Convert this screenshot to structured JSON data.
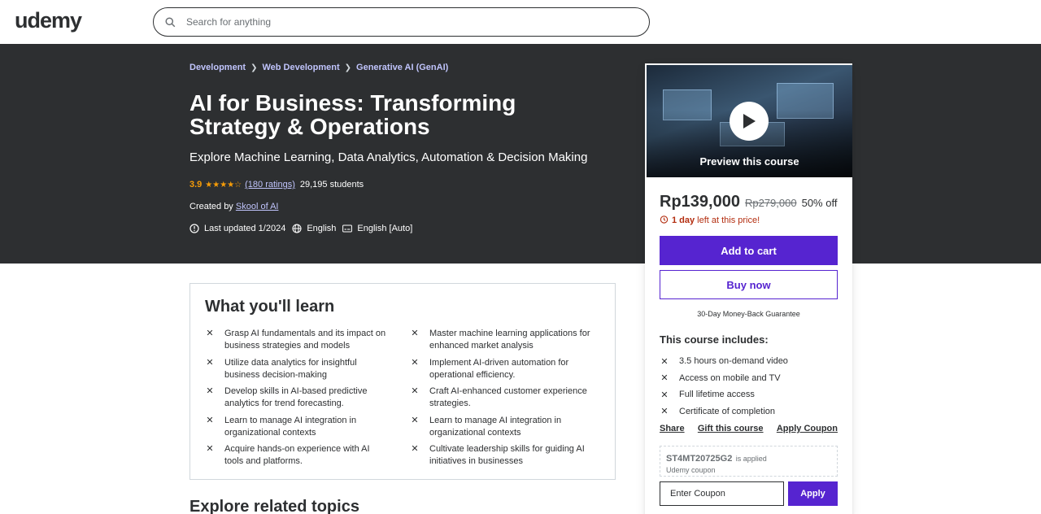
{
  "header": {
    "logo": "udemy",
    "search_placeholder": "Search for anything"
  },
  "breadcrumbs": [
    "Development",
    "Web Development",
    "Generative AI (GenAI)"
  ],
  "course": {
    "title": "AI for Business: Transforming Strategy & Operations",
    "subtitle": "Explore Machine Learning, Data Analytics, Automation & Decision Making",
    "rating": "3.9",
    "stars_value": 3.9,
    "ratings_count": "(180 ratings)",
    "students": "29,195 students",
    "created_by_label": "Created by",
    "instructor": "Skool of AI",
    "last_updated": "Last updated 1/2024",
    "language": "English",
    "captions": "English [Auto]"
  },
  "sidebar": {
    "preview_label": "Preview this course",
    "price": "Rp139,000",
    "original_price": "Rp279,000",
    "discount": "50% off",
    "timer_bold": "1 day",
    "timer_rest": "left at this price!",
    "add_to_cart": "Add to cart",
    "buy_now": "Buy now",
    "guarantee": "30-Day Money-Back Guarantee",
    "includes_title": "This course includes:",
    "includes": [
      {
        "icon": "video-icon",
        "label": "3.5 hours on-demand video"
      },
      {
        "icon": "mobile-icon",
        "label": "Access on mobile and TV"
      },
      {
        "icon": "infinity-icon",
        "label": "Full lifetime access"
      },
      {
        "icon": "trophy-icon",
        "label": "Certificate of completion"
      }
    ],
    "share": "Share",
    "gift": "Gift this course",
    "apply_coupon": "Apply Coupon",
    "coupon_code": "ST4MT20725G2",
    "coupon_applied": "is applied",
    "coupon_sub": "Udemy coupon",
    "coupon_placeholder": "Enter Coupon",
    "apply": "Apply"
  },
  "learn": {
    "title": "What you'll learn",
    "items": [
      "Grasp AI fundamentals and its impact on business strategies and models",
      "Master machine learning applications for enhanced market analysis",
      "Utilize data analytics for insightful business decision-making",
      "Implement AI-driven automation for operational efficiency.",
      "Develop skills in AI-based predictive analytics for trend forecasting.",
      "Craft AI-enhanced customer experience strategies.",
      "Learn to manage AI integration in organizational contexts",
      "Learn to manage AI integration in organizational contexts",
      "Acquire hands-on experience with AI tools and platforms.",
      "Cultivate leadership skills for guiding AI initiatives in businesses"
    ]
  },
  "related_title": "Explore related topics",
  "colors": {
    "hero_bg": "#2d2f31",
    "accent": "#5624d0",
    "link_light": "#c0c4fc",
    "star": "#f69c08",
    "timer": "#b32d0f"
  }
}
